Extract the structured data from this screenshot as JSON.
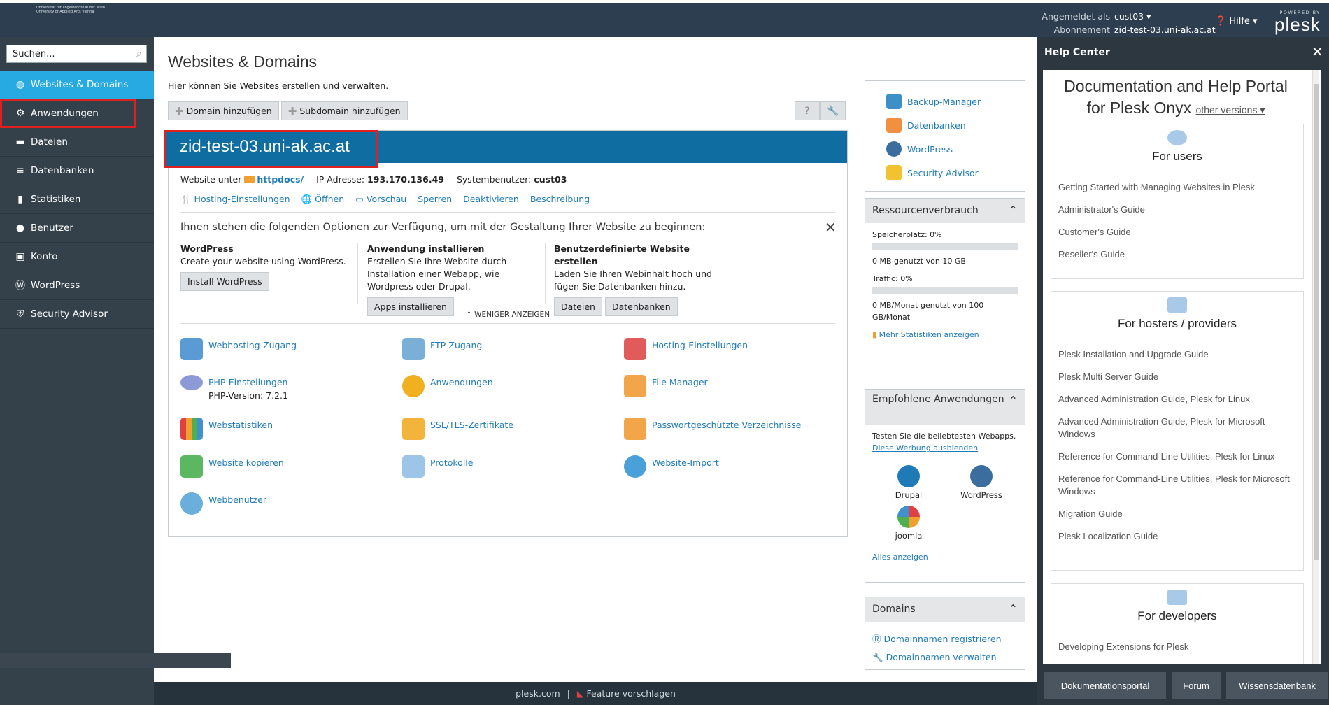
{
  "header": {
    "logo_text": "dı:'ʌngewʌndtə",
    "logo_sub1": "Universität für angewandte Kunst Wien",
    "logo_sub2": "University of Applied Arts Vienna",
    "logged_in_label": "Angemeldet als",
    "logged_in_user": "cust03 ▾",
    "subscription_label": "Abonnement",
    "subscription_value": "zid-test-03.uni-ak.ac.at",
    "help_label": "Hilfe ▾",
    "powered_by": "POWERED BY",
    "plesk": "plesk"
  },
  "sidebar": {
    "search_placeholder": "Suchen...",
    "items": [
      {
        "label": "Websites & Domains",
        "icon": "globe-icon"
      },
      {
        "label": "Anwendungen",
        "icon": "gear-icon"
      },
      {
        "label": "Dateien",
        "icon": "folder-icon"
      },
      {
        "label": "Datenbanken",
        "icon": "database-icon"
      },
      {
        "label": "Statistiken",
        "icon": "chart-icon"
      },
      {
        "label": "Benutzer",
        "icon": "user-icon"
      },
      {
        "label": "Konto",
        "icon": "account-icon"
      },
      {
        "label": "WordPress",
        "icon": "wordpress-icon"
      },
      {
        "label": "Security Advisor",
        "icon": "shield-icon"
      }
    ]
  },
  "main": {
    "title": "Websites & Domains",
    "description": "Hier können Sie Websites erstellen und verwalten.",
    "add_domain": "Domain hinzufügen",
    "add_subdomain": "Subdomain hinzufügen",
    "domain": {
      "name": "zid-test-03.uni-ak.ac.at",
      "website_under_label": "Website unter",
      "website_under_value": "httpdocs/",
      "ip_label": "IP-Adresse:",
      "ip_value": "193.170.136.49",
      "sysuser_label": "Systembenutzer:",
      "sysuser_value": "cust03",
      "links": [
        "Hosting-Einstellungen",
        "Öffnen",
        "Vorschau",
        "Sperren",
        "Deaktivieren",
        "Beschreibung"
      ],
      "options_title": "Ihnen stehen die folgenden Optionen zur Verfügung, um mit der Gestaltung Ihrer Website zu beginnen:",
      "wp_title": "WordPress",
      "wp_text": "Create your website using WordPress.",
      "wp_button": "Install WordPress",
      "app_title": "Anwendung installieren",
      "app_text": "Erstellen Sie Ihre Website durch Installation einer Webapp, wie Wordpress oder Drupal.",
      "app_button": "Apps installieren",
      "custom_title": "Benutzerdefinierte Website erstellen",
      "custom_text": "Laden Sie Ihren Webinhalt hoch und fügen Sie Datenbanken hinzu.",
      "custom_btn1": "Dateien",
      "custom_btn2": "Datenbanken",
      "show_less": "⌃ WENIGER ANZEIGEN",
      "tiles": {
        "webhosting": "Webhosting-Zugang",
        "ftp": "FTP-Zugang",
        "hosting": "Hosting-Einstellungen",
        "php": "PHP-Einstellungen",
        "php_version": "PHP-Version: 7.2.1",
        "apps": "Anwendungen",
        "filemanager": "File Manager",
        "webstats": "Webstatistiken",
        "ssl": "SSL/TLS-Zertifikate",
        "protected": "Passwortgeschützte Verzeichnisse",
        "copy": "Website kopieren",
        "logs": "Protokolle",
        "import": "Website-Import",
        "webusers": "Webbenutzer"
      }
    }
  },
  "right": {
    "quick_links": [
      "Backup-Manager",
      "Datenbanken",
      "WordPress",
      "Security Advisor"
    ],
    "resources_title": "Ressourcenverbrauch",
    "storage_label": "Speicherplatz: 0%",
    "storage_used": "0 MB genutzt von 10 GB",
    "traffic_label": "Traffic: 0%",
    "traffic_used": "0 MB/Monat genutzt von 100 GB/Monat",
    "more_stats": "Mehr Statistiken anzeigen",
    "recommended_title": "Empfohlene Anwendungen",
    "recommended_text": "Testen Sie die beliebtesten Webapps.",
    "hide_ad": "Diese Werbung ausblenden",
    "apps": [
      "Drupal",
      "WordPress",
      "joomla"
    ],
    "show_all": "Alles anzeigen",
    "domains_title": "Domains",
    "register": "Domainnamen registrieren",
    "manage": "Domainnamen verwalten"
  },
  "help_center": {
    "title": "Help Center",
    "heading1": "Documentation and Help Portal",
    "heading2": "for Plesk Onyx",
    "other_versions": "other versions ▾",
    "users_title": "For users",
    "users_links": [
      "Getting Started with Managing Websites in Plesk",
      "Administrator's Guide",
      "Customer's Guide",
      "Reseller's Guide"
    ],
    "hosters_title": "For hosters / providers",
    "hosters_links": [
      "Plesk Installation and Upgrade Guide",
      "Plesk Multi Server Guide",
      "Advanced Administration Guide, Plesk for Linux",
      "Advanced Administration Guide, Plesk for Microsoft Windows",
      "Reference for Command-Line Utilities, Plesk for Linux",
      "Reference for Command-Line Utilities, Plesk for Microsoft Windows",
      "Migration Guide",
      "Plesk Localization Guide"
    ],
    "dev_title": "For developers",
    "dev_links": [
      "Developing Extensions for Plesk"
    ],
    "buttons": [
      "Dokumentationsportal",
      "Forum",
      "Wissensdatenbank"
    ]
  },
  "footer": {
    "plesk_com": "plesk.com",
    "suggest": "Feature vorschlagen"
  },
  "colors": {
    "accent": "#27aae1",
    "domain_header": "#0f6da1",
    "highlight": "#e02020",
    "sidebar": "#34404a"
  }
}
